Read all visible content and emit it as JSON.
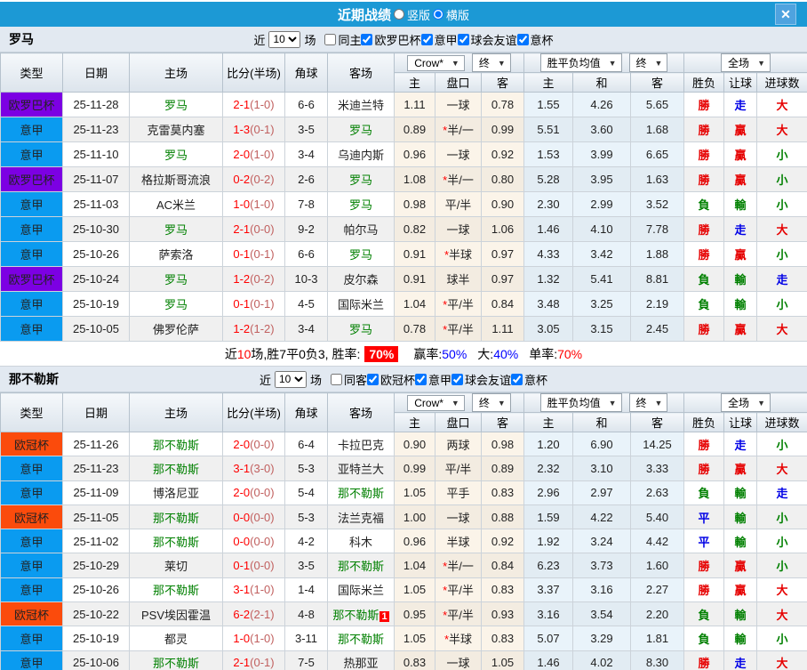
{
  "titlebar": {
    "title": "近期战绩",
    "radios": [
      {
        "label": "竖版",
        "checked": false
      },
      {
        "label": "横版",
        "checked": true
      }
    ]
  },
  "icons": {
    "dropdown_arrow": "▼",
    "close": "✕"
  },
  "colors": {
    "titlebar_bg": "#1C99D5",
    "league": {
      "欧罗巴杯": "#7C00E3",
      "意甲": "#0A9BF0",
      "欧冠杯": "#FB4B0C"
    },
    "result": {
      "勝": "#E60000",
      "贏": "#E60000",
      "大": "#E60000",
      "負": "#008000",
      "輸": "#008000",
      "小": "#008000",
      "平": "#0000E6",
      "走": "#0000E6"
    },
    "self_team": "#008000",
    "score_fulltime": "#FF0000",
    "score_halftime": "#C1605F",
    "badge_bg": "#FF0000"
  },
  "table": {
    "main_headers": [
      "类型",
      "日期",
      "主场",
      "比分(半场)",
      "角球",
      "客场"
    ],
    "sub_headers": [
      "主",
      "盘口",
      "客",
      "主",
      "和",
      "客",
      "胜负",
      "让球",
      "进球数"
    ]
  },
  "sections": [
    {
      "team": "罗马",
      "filters": {
        "near_label": "近",
        "count": "10",
        "games_label": "场",
        "same_label": "同主",
        "same_checked": false,
        "leagues": [
          {
            "label": "欧罗巴杯",
            "checked": true
          },
          {
            "label": "意甲",
            "checked": true
          },
          {
            "label": "球会友谊",
            "checked": true
          },
          {
            "label": "意杯",
            "checked": true
          }
        ]
      },
      "dropdowns": {
        "odds_source": "Crow*",
        "odds_time": "终",
        "avg_source": "胜平负均值",
        "avg_time": "终",
        "scope": "全场"
      },
      "rows": [
        {
          "league": "欧罗巴杯",
          "date": "25-11-28",
          "home": "罗马",
          "home_self": true,
          "ft": "2-1",
          "ht": "(1-0)",
          "corners": "6-6",
          "away": "米迪兰特",
          "away_self": false,
          "odds": {
            "home": "1.11",
            "star": "",
            "handicap": "一球",
            "away": "0.78"
          },
          "avg": {
            "home": "1.55",
            "draw": "4.26",
            "away": "5.65"
          },
          "results": [
            "勝",
            "走",
            "大"
          ]
        },
        {
          "league": "意甲",
          "date": "25-11-23",
          "home": "克雷莫内塞",
          "home_self": false,
          "ft": "1-3",
          "ht": "(0-1)",
          "corners": "3-5",
          "away": "罗马",
          "away_self": true,
          "odds": {
            "home": "0.89",
            "star": "*",
            "handicap": "半/一",
            "away": "0.99"
          },
          "avg": {
            "home": "5.51",
            "draw": "3.60",
            "away": "1.68"
          },
          "results": [
            "勝",
            "贏",
            "大"
          ]
        },
        {
          "league": "意甲",
          "date": "25-11-10",
          "home": "罗马",
          "home_self": true,
          "ft": "2-0",
          "ht": "(1-0)",
          "corners": "3-4",
          "away": "乌迪内斯",
          "away_self": false,
          "odds": {
            "home": "0.96",
            "star": "",
            "handicap": "一球",
            "away": "0.92"
          },
          "avg": {
            "home": "1.53",
            "draw": "3.99",
            "away": "6.65"
          },
          "results": [
            "勝",
            "贏",
            "小"
          ]
        },
        {
          "league": "欧罗巴杯",
          "date": "25-11-07",
          "home": "格拉斯哥流浪",
          "home_self": false,
          "ft": "0-2",
          "ht": "(0-2)",
          "corners": "2-6",
          "away": "罗马",
          "away_self": true,
          "odds": {
            "home": "1.08",
            "star": "*",
            "handicap": "半/一",
            "away": "0.80"
          },
          "avg": {
            "home": "5.28",
            "draw": "3.95",
            "away": "1.63"
          },
          "results": [
            "勝",
            "贏",
            "小"
          ]
        },
        {
          "league": "意甲",
          "date": "25-11-03",
          "home": "AC米兰",
          "home_self": false,
          "ft": "1-0",
          "ht": "(1-0)",
          "corners": "7-8",
          "away": "罗马",
          "away_self": true,
          "odds": {
            "home": "0.98",
            "star": "",
            "handicap": "平/半",
            "away": "0.90"
          },
          "avg": {
            "home": "2.30",
            "draw": "2.99",
            "away": "3.52"
          },
          "results": [
            "負",
            "輸",
            "小"
          ]
        },
        {
          "league": "意甲",
          "date": "25-10-30",
          "home": "罗马",
          "home_self": true,
          "ft": "2-1",
          "ht": "(0-0)",
          "corners": "9-2",
          "away": "帕尔马",
          "away_self": false,
          "odds": {
            "home": "0.82",
            "star": "",
            "handicap": "一球",
            "away": "1.06"
          },
          "avg": {
            "home": "1.46",
            "draw": "4.10",
            "away": "7.78"
          },
          "results": [
            "勝",
            "走",
            "大"
          ]
        },
        {
          "league": "意甲",
          "date": "25-10-26",
          "home": "萨索洛",
          "home_self": false,
          "ft": "0-1",
          "ht": "(0-1)",
          "corners": "6-6",
          "away": "罗马",
          "away_self": true,
          "odds": {
            "home": "0.91",
            "star": "*",
            "handicap": "半球",
            "away": "0.97"
          },
          "avg": {
            "home": "4.33",
            "draw": "3.42",
            "away": "1.88"
          },
          "results": [
            "勝",
            "贏",
            "小"
          ]
        },
        {
          "league": "欧罗巴杯",
          "date": "25-10-24",
          "home": "罗马",
          "home_self": true,
          "ft": "1-2",
          "ht": "(0-2)",
          "corners": "10-3",
          "away": "皮尔森",
          "away_self": false,
          "odds": {
            "home": "0.91",
            "star": "",
            "handicap": "球半",
            "away": "0.97"
          },
          "avg": {
            "home": "1.32",
            "draw": "5.41",
            "away": "8.81"
          },
          "results": [
            "負",
            "輸",
            "走"
          ]
        },
        {
          "league": "意甲",
          "date": "25-10-19",
          "home": "罗马",
          "home_self": true,
          "ft": "0-1",
          "ht": "(0-1)",
          "corners": "4-5",
          "away": "国际米兰",
          "away_self": false,
          "odds": {
            "home": "1.04",
            "star": "*",
            "handicap": "平/半",
            "away": "0.84"
          },
          "avg": {
            "home": "3.48",
            "draw": "3.25",
            "away": "2.19"
          },
          "results": [
            "負",
            "輸",
            "小"
          ]
        },
        {
          "league": "意甲",
          "date": "25-10-05",
          "home": "佛罗伦萨",
          "home_self": false,
          "ft": "1-2",
          "ht": "(1-2)",
          "corners": "3-4",
          "away": "罗马",
          "away_self": true,
          "odds": {
            "home": "0.78",
            "star": "*",
            "handicap": "平/半",
            "away": "1.11"
          },
          "avg": {
            "home": "3.05",
            "draw": "3.15",
            "away": "2.45"
          },
          "results": [
            "勝",
            "贏",
            "大"
          ]
        }
      ],
      "summary": {
        "prefix": [
          {
            "text": "近",
            "color": "#000000"
          },
          {
            "text": "10",
            "color": "#FF0000"
          },
          {
            "text": "场,胜7平0负3, 胜率:",
            "color": "#000000"
          }
        ],
        "win_rate_badge": "70%",
        "stats": [
          {
            "label": "赢率:",
            "value": "50%",
            "value_color": "#0000FF"
          },
          {
            "label": "大:",
            "value": "40%",
            "value_color": "#0000FF"
          },
          {
            "label": "单率:",
            "value": "70%",
            "value_color": "#FF0000"
          }
        ]
      }
    },
    {
      "team": "那不勒斯",
      "filters": {
        "near_label": "近",
        "count": "10",
        "games_label": "场",
        "same_label": "同客",
        "same_checked": false,
        "leagues": [
          {
            "label": "欧冠杯",
            "checked": true
          },
          {
            "label": "意甲",
            "checked": true
          },
          {
            "label": "球会友谊",
            "checked": true
          },
          {
            "label": "意杯",
            "checked": true
          }
        ]
      },
      "dropdowns": {
        "odds_source": "Crow*",
        "odds_time": "终",
        "avg_source": "胜平负均值",
        "avg_time": "终",
        "scope": "全场"
      },
      "rows": [
        {
          "league": "欧冠杯",
          "date": "25-11-26",
          "home": "那不勒斯",
          "home_self": true,
          "ft": "2-0",
          "ht": "(0-0)",
          "corners": "6-4",
          "away": "卡拉巴克",
          "away_self": false,
          "odds": {
            "home": "0.90",
            "star": "",
            "handicap": "两球",
            "away": "0.98"
          },
          "avg": {
            "home": "1.20",
            "draw": "6.90",
            "away": "14.25"
          },
          "results": [
            "勝",
            "走",
            "小"
          ]
        },
        {
          "league": "意甲",
          "date": "25-11-23",
          "home": "那不勒斯",
          "home_self": true,
          "ft": "3-1",
          "ht": "(3-0)",
          "corners": "5-3",
          "away": "亚特兰大",
          "away_self": false,
          "odds": {
            "home": "0.99",
            "star": "",
            "handicap": "平/半",
            "away": "0.89"
          },
          "avg": {
            "home": "2.32",
            "draw": "3.10",
            "away": "3.33"
          },
          "results": [
            "勝",
            "贏",
            "大"
          ]
        },
        {
          "league": "意甲",
          "date": "25-11-09",
          "home": "博洛尼亚",
          "home_self": false,
          "ft": "2-0",
          "ht": "(0-0)",
          "corners": "5-4",
          "away": "那不勒斯",
          "away_self": true,
          "odds": {
            "home": "1.05",
            "star": "",
            "handicap": "平手",
            "away": "0.83"
          },
          "avg": {
            "home": "2.96",
            "draw": "2.97",
            "away": "2.63"
          },
          "results": [
            "負",
            "輸",
            "走"
          ]
        },
        {
          "league": "欧冠杯",
          "date": "25-11-05",
          "home": "那不勒斯",
          "home_self": true,
          "ft": "0-0",
          "ht": "(0-0)",
          "corners": "5-3",
          "away": "法兰克福",
          "away_self": false,
          "odds": {
            "home": "1.00",
            "star": "",
            "handicap": "一球",
            "away": "0.88"
          },
          "avg": {
            "home": "1.59",
            "draw": "4.22",
            "away": "5.40"
          },
          "results": [
            "平",
            "輸",
            "小"
          ]
        },
        {
          "league": "意甲",
          "date": "25-11-02",
          "home": "那不勒斯",
          "home_self": true,
          "ft": "0-0",
          "ht": "(0-0)",
          "corners": "4-2",
          "away": "科木",
          "away_self": false,
          "odds": {
            "home": "0.96",
            "star": "",
            "handicap": "半球",
            "away": "0.92"
          },
          "avg": {
            "home": "1.92",
            "draw": "3.24",
            "away": "4.42"
          },
          "results": [
            "平",
            "輸",
            "小"
          ]
        },
        {
          "league": "意甲",
          "date": "25-10-29",
          "home": "莱切",
          "home_self": false,
          "ft": "0-1",
          "ht": "(0-0)",
          "corners": "3-5",
          "away": "那不勒斯",
          "away_self": true,
          "odds": {
            "home": "1.04",
            "star": "*",
            "handicap": "半/一",
            "away": "0.84"
          },
          "avg": {
            "home": "6.23",
            "draw": "3.73",
            "away": "1.60"
          },
          "results": [
            "勝",
            "贏",
            "小"
          ]
        },
        {
          "league": "意甲",
          "date": "25-10-26",
          "home": "那不勒斯",
          "home_self": true,
          "ft": "3-1",
          "ht": "(1-0)",
          "corners": "1-4",
          "away": "国际米兰",
          "away_self": false,
          "odds": {
            "home": "1.05",
            "star": "*",
            "handicap": "平/半",
            "away": "0.83"
          },
          "avg": {
            "home": "3.37",
            "draw": "3.16",
            "away": "2.27"
          },
          "results": [
            "勝",
            "贏",
            "大"
          ]
        },
        {
          "league": "欧冠杯",
          "date": "25-10-22",
          "home": "PSV埃因霍温",
          "home_self": false,
          "ft": "6-2",
          "ht": "(2-1)",
          "corners": "4-8",
          "away": "那不勒斯",
          "away_self": true,
          "away_badge": "1",
          "odds": {
            "home": "0.95",
            "star": "*",
            "handicap": "平/半",
            "away": "0.93"
          },
          "avg": {
            "home": "3.16",
            "draw": "3.54",
            "away": "2.20"
          },
          "results": [
            "負",
            "輸",
            "大"
          ]
        },
        {
          "league": "意甲",
          "date": "25-10-19",
          "home": "都灵",
          "home_self": false,
          "ft": "1-0",
          "ht": "(1-0)",
          "corners": "3-11",
          "away": "那不勒斯",
          "away_self": true,
          "odds": {
            "home": "1.05",
            "star": "*",
            "handicap": "半球",
            "away": "0.83"
          },
          "avg": {
            "home": "5.07",
            "draw": "3.29",
            "away": "1.81"
          },
          "results": [
            "負",
            "輸",
            "小"
          ]
        },
        {
          "league": "意甲",
          "date": "25-10-06",
          "home": "那不勒斯",
          "home_self": true,
          "ft": "2-1",
          "ht": "(0-1)",
          "corners": "7-5",
          "away": "热那亚",
          "away_self": false,
          "odds": {
            "home": "0.83",
            "star": "",
            "handicap": "一球",
            "away": "1.05"
          },
          "avg": {
            "home": "1.46",
            "draw": "4.02",
            "away": "8.30"
          },
          "results": [
            "勝",
            "走",
            "大"
          ]
        }
      ]
    }
  ]
}
